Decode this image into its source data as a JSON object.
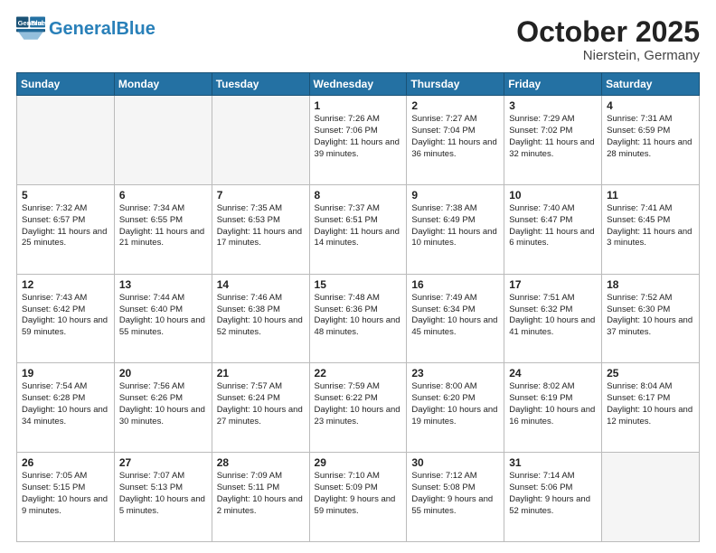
{
  "header": {
    "logo_general": "General",
    "logo_blue": "Blue",
    "month_title": "October 2025",
    "location": "Nierstein, Germany"
  },
  "days_of_week": [
    "Sunday",
    "Monday",
    "Tuesday",
    "Wednesday",
    "Thursday",
    "Friday",
    "Saturday"
  ],
  "weeks": [
    [
      {
        "day": "",
        "content": ""
      },
      {
        "day": "",
        "content": ""
      },
      {
        "day": "",
        "content": ""
      },
      {
        "day": "1",
        "content": "Sunrise: 7:26 AM\nSunset: 7:06 PM\nDaylight: 11 hours\nand 39 minutes."
      },
      {
        "day": "2",
        "content": "Sunrise: 7:27 AM\nSunset: 7:04 PM\nDaylight: 11 hours\nand 36 minutes."
      },
      {
        "day": "3",
        "content": "Sunrise: 7:29 AM\nSunset: 7:02 PM\nDaylight: 11 hours\nand 32 minutes."
      },
      {
        "day": "4",
        "content": "Sunrise: 7:31 AM\nSunset: 6:59 PM\nDaylight: 11 hours\nand 28 minutes."
      }
    ],
    [
      {
        "day": "5",
        "content": "Sunrise: 7:32 AM\nSunset: 6:57 PM\nDaylight: 11 hours\nand 25 minutes."
      },
      {
        "day": "6",
        "content": "Sunrise: 7:34 AM\nSunset: 6:55 PM\nDaylight: 11 hours\nand 21 minutes."
      },
      {
        "day": "7",
        "content": "Sunrise: 7:35 AM\nSunset: 6:53 PM\nDaylight: 11 hours\nand 17 minutes."
      },
      {
        "day": "8",
        "content": "Sunrise: 7:37 AM\nSunset: 6:51 PM\nDaylight: 11 hours\nand 14 minutes."
      },
      {
        "day": "9",
        "content": "Sunrise: 7:38 AM\nSunset: 6:49 PM\nDaylight: 11 hours\nand 10 minutes."
      },
      {
        "day": "10",
        "content": "Sunrise: 7:40 AM\nSunset: 6:47 PM\nDaylight: 11 hours\nand 6 minutes."
      },
      {
        "day": "11",
        "content": "Sunrise: 7:41 AM\nSunset: 6:45 PM\nDaylight: 11 hours\nand 3 minutes."
      }
    ],
    [
      {
        "day": "12",
        "content": "Sunrise: 7:43 AM\nSunset: 6:42 PM\nDaylight: 10 hours\nand 59 minutes."
      },
      {
        "day": "13",
        "content": "Sunrise: 7:44 AM\nSunset: 6:40 PM\nDaylight: 10 hours\nand 55 minutes."
      },
      {
        "day": "14",
        "content": "Sunrise: 7:46 AM\nSunset: 6:38 PM\nDaylight: 10 hours\nand 52 minutes."
      },
      {
        "day": "15",
        "content": "Sunrise: 7:48 AM\nSunset: 6:36 PM\nDaylight: 10 hours\nand 48 minutes."
      },
      {
        "day": "16",
        "content": "Sunrise: 7:49 AM\nSunset: 6:34 PM\nDaylight: 10 hours\nand 45 minutes."
      },
      {
        "day": "17",
        "content": "Sunrise: 7:51 AM\nSunset: 6:32 PM\nDaylight: 10 hours\nand 41 minutes."
      },
      {
        "day": "18",
        "content": "Sunrise: 7:52 AM\nSunset: 6:30 PM\nDaylight: 10 hours\nand 37 minutes."
      }
    ],
    [
      {
        "day": "19",
        "content": "Sunrise: 7:54 AM\nSunset: 6:28 PM\nDaylight: 10 hours\nand 34 minutes."
      },
      {
        "day": "20",
        "content": "Sunrise: 7:56 AM\nSunset: 6:26 PM\nDaylight: 10 hours\nand 30 minutes."
      },
      {
        "day": "21",
        "content": "Sunrise: 7:57 AM\nSunset: 6:24 PM\nDaylight: 10 hours\nand 27 minutes."
      },
      {
        "day": "22",
        "content": "Sunrise: 7:59 AM\nSunset: 6:22 PM\nDaylight: 10 hours\nand 23 minutes."
      },
      {
        "day": "23",
        "content": "Sunrise: 8:00 AM\nSunset: 6:20 PM\nDaylight: 10 hours\nand 19 minutes."
      },
      {
        "day": "24",
        "content": "Sunrise: 8:02 AM\nSunset: 6:19 PM\nDaylight: 10 hours\nand 16 minutes."
      },
      {
        "day": "25",
        "content": "Sunrise: 8:04 AM\nSunset: 6:17 PM\nDaylight: 10 hours\nand 12 minutes."
      }
    ],
    [
      {
        "day": "26",
        "content": "Sunrise: 7:05 AM\nSunset: 5:15 PM\nDaylight: 10 hours\nand 9 minutes."
      },
      {
        "day": "27",
        "content": "Sunrise: 7:07 AM\nSunset: 5:13 PM\nDaylight: 10 hours\nand 5 minutes."
      },
      {
        "day": "28",
        "content": "Sunrise: 7:09 AM\nSunset: 5:11 PM\nDaylight: 10 hours\nand 2 minutes."
      },
      {
        "day": "29",
        "content": "Sunrise: 7:10 AM\nSunset: 5:09 PM\nDaylight: 9 hours\nand 59 minutes."
      },
      {
        "day": "30",
        "content": "Sunrise: 7:12 AM\nSunset: 5:08 PM\nDaylight: 9 hours\nand 55 minutes."
      },
      {
        "day": "31",
        "content": "Sunrise: 7:14 AM\nSunset: 5:06 PM\nDaylight: 9 hours\nand 52 minutes."
      },
      {
        "day": "",
        "content": ""
      }
    ]
  ]
}
